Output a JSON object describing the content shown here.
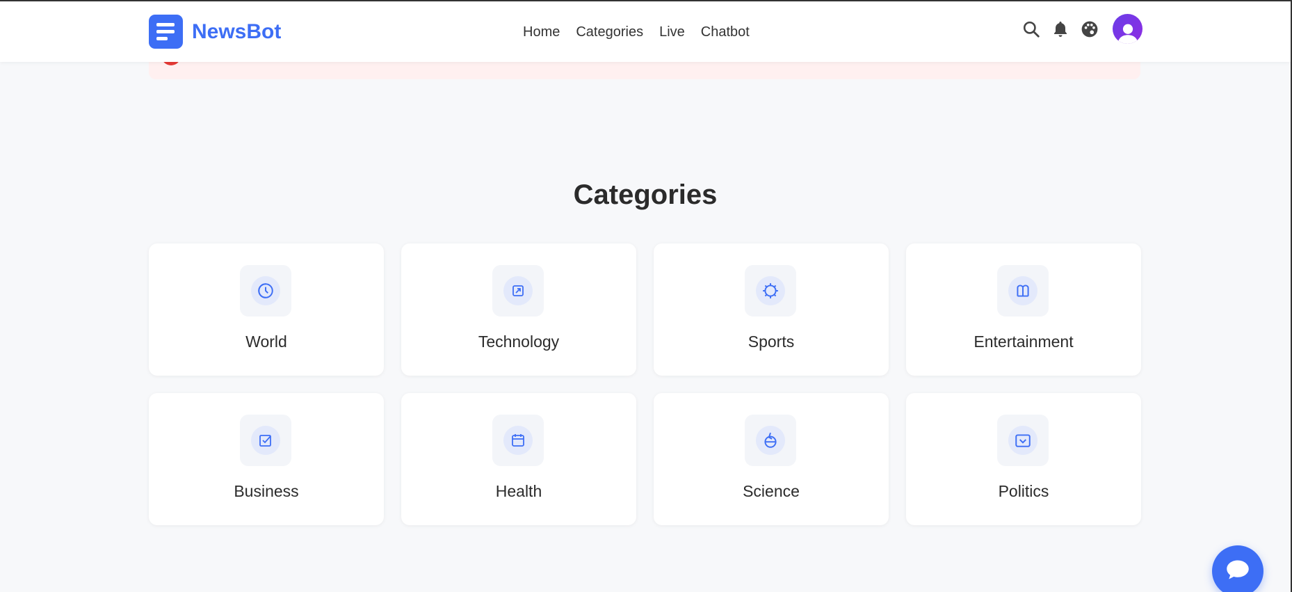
{
  "app": {
    "name": "NewsBot",
    "brand_color": "#3d6ef5"
  },
  "alert": {
    "text": "",
    "color": "#e53935"
  },
  "nav": {
    "items": [
      {
        "label": "Home"
      },
      {
        "label": "Categories"
      },
      {
        "label": "Live"
      },
      {
        "label": "Chatbot"
      }
    ]
  },
  "header_actions": {
    "icons": [
      "search-icon",
      "bell-icon",
      "palette-icon",
      "user-avatar"
    ]
  },
  "section": {
    "title": "Categories"
  },
  "categories": [
    {
      "label": "World",
      "icon": "globe-icon"
    },
    {
      "label": "Technology",
      "icon": "chip-icon"
    },
    {
      "label": "Sports",
      "icon": "ball-icon"
    },
    {
      "label": "Entertainment",
      "icon": "film-icon"
    },
    {
      "label": "Business",
      "icon": "briefcase-icon"
    },
    {
      "label": "Health",
      "icon": "heart-icon"
    },
    {
      "label": "Science",
      "icon": "flask-icon"
    },
    {
      "label": "Politics",
      "icon": "ballot-icon"
    }
  ],
  "chat_fab": {
    "icon": "chat-bubble-icon"
  }
}
